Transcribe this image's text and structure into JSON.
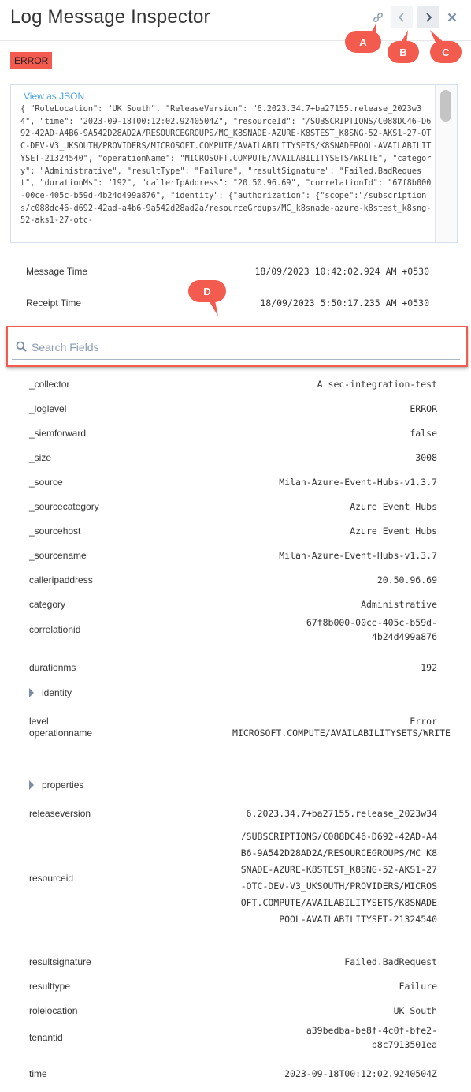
{
  "header": {
    "title": "Log Message Inspector",
    "icons": {
      "link": "link-icon",
      "prev": "chevron-left-icon",
      "next": "chevron-right-icon",
      "close": "close-icon"
    }
  },
  "callouts": [
    "A",
    "B",
    "C",
    "D"
  ],
  "badge": {
    "label": "ERROR",
    "color": "#f45b4f"
  },
  "json_panel": {
    "link_label": "View as JSON",
    "text": "{ \"RoleLocation\": \"UK South\", \"ReleaseVersion\": \"6.2023.34.7+ba27155.release_2023w34\", \"time\": \"2023-09-18T00:12:02.9240504Z\", \"resourceId\": \"/SUBSCRIPTIONS/C088DC46-D692-42AD-A4B6-9A542D28AD2A/RESOURCEGROUPS/MC_K8SNADE-AZURE-K8STEST_K8SNG-52-AKS1-27-OTC-DEV-V3_UKSOUTH/PROVIDERS/MICROSOFT.COMPUTE/AVAILABILITYSETS/K8SNADEPOOL-AVAILABILITYSET-21324540\", \"operationName\": \"MICROSOFT.COMPUTE/AVAILABILITYSETS/WRITE\", \"category\": \"Administrative\", \"resultType\": \"Failure\", \"resultSignature\": \"Failed.BadRequest\", \"durationMs\": \"192\", \"callerIpAddress\": \"20.50.96.69\", \"correlationId\": \"67f8b000-00ce-405c-b59d-4b24d499a876\", \"identity\": {\"authorization\": {\"scope\":\"/subscriptions/c088dc46-d692-42ad-a4b6-9a542d28ad2a/resourceGroups/MC_k8snade-azure-k8stest_k8sng-52-aks1-27-otc-"
  },
  "meta": {
    "message_time_label": "Message Time",
    "message_time_value": "18/09/2023 10:42:02.924 AM +0530",
    "receipt_time_label": "Receipt Time",
    "receipt_time_value": "18/09/2023 5:50:17.235 AM +0530"
  },
  "search": {
    "placeholder": "Search Fields",
    "value": ""
  },
  "fields": [
    {
      "name": "_collector",
      "value": "A sec-integration-test"
    },
    {
      "name": "_loglevel",
      "value": "ERROR"
    },
    {
      "name": "_siemforward",
      "value": "false"
    },
    {
      "name": "_size",
      "value": "3008"
    },
    {
      "name": "_source",
      "value": "Milan-Azure-Event-Hubs-v1.3.7"
    },
    {
      "name": "_sourcecategory",
      "value": "Azure Event Hubs"
    },
    {
      "name": "_sourcehost",
      "value": "Azure Event Hubs"
    },
    {
      "name": "_sourcename",
      "value": "Milan-Azure-Event-Hubs-v1.3.7"
    },
    {
      "name": "calleripaddress",
      "value": "20.50.96.69"
    },
    {
      "name": "category",
      "value": "Administrative"
    },
    {
      "name": "correlationid",
      "value": "67f8b000-00ce-405c-b59d-4b24d499a876"
    },
    {
      "name": "durationms",
      "value": "192"
    },
    {
      "name": "identity",
      "value": "",
      "expandable": true
    },
    {
      "name": "level",
      "value": "Error"
    },
    {
      "name": "operationname",
      "value": "MICROSOFT.COMPUTE/AVAILABILITYSETS/WRITE"
    },
    {
      "name": "properties",
      "value": "",
      "expandable": true
    },
    {
      "name": "releaseversion",
      "value": "6.2023.34.7+ba27155.release_2023w34"
    },
    {
      "name": "resourceid",
      "value": "/SUBSCRIPTIONS/C088DC46-D692-42AD-A4B6-9A542D28AD2A/RESOURCEGROUPS/MC_K8SNADE-AZURE-K8STEST_K8SNG-52-AKS1-27-OTC-DEV-V3_UKSOUTH/PROVIDERS/MICROSOFT.COMPUTE/AVAILABILITYSETS/K8SNADEPOOL-AVAILABILITYSET-21324540"
    },
    {
      "name": "resultsignature",
      "value": "Failed.BadRequest"
    },
    {
      "name": "resulttype",
      "value": "Failure"
    },
    {
      "name": "rolelocation",
      "value": "UK South"
    },
    {
      "name": "tenantid",
      "value": "a39bedba-be8f-4c0f-bfe2-b8c7913501ea"
    },
    {
      "name": "time",
      "value": "2023-09-18T00:12:02.9240504Z"
    }
  ]
}
